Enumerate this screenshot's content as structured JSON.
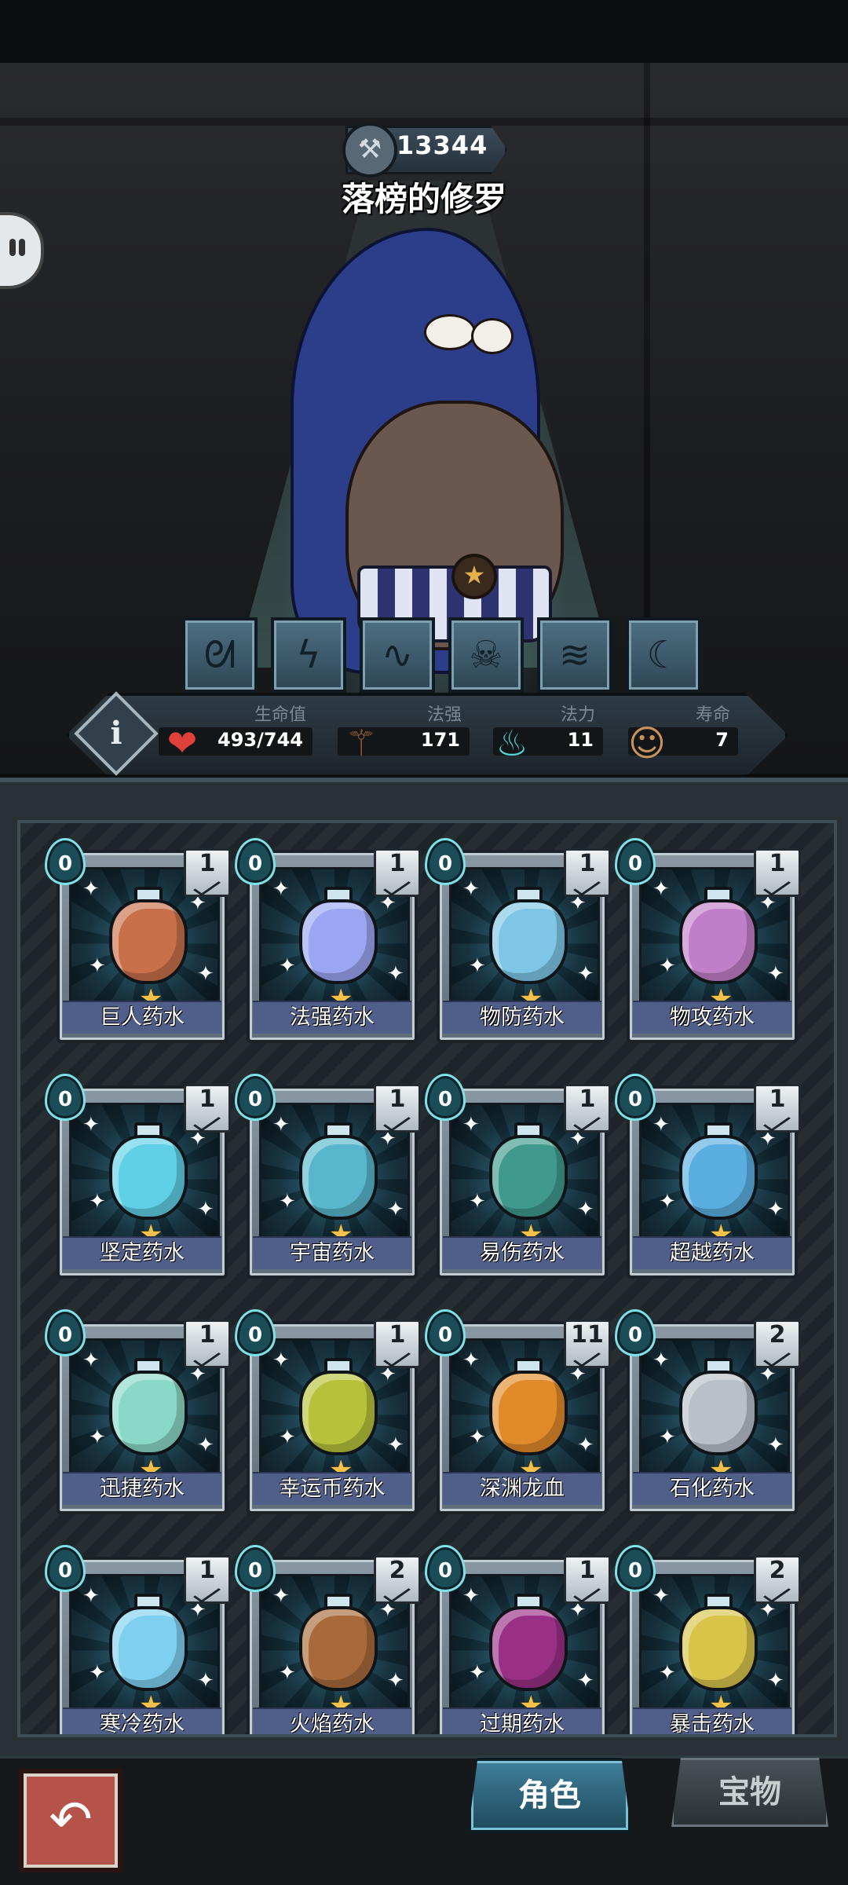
{
  "character": {
    "score": "13344",
    "name": "落榜的修罗"
  },
  "skills": [
    {
      "icon": "beast-skill-icon"
    },
    {
      "icon": "lightning-skill-icon"
    },
    {
      "icon": "wind-skill-icon"
    },
    {
      "icon": "skull-skill-icon"
    },
    {
      "icon": "claw-skill-icon"
    },
    {
      "icon": "wave-skill-icon"
    }
  ],
  "stats": {
    "hp": {
      "label": "生命值",
      "value": "493/744",
      "icon": "heart-icon"
    },
    "magic_power": {
      "label": "法强",
      "value": "171",
      "icon": "staff-icon"
    },
    "mana": {
      "label": "法力",
      "value": "11",
      "icon": "soul-flame-icon"
    },
    "lifespan": {
      "label": "寿命",
      "value": "7",
      "icon": "portrait-icon"
    }
  },
  "potions": [
    {
      "name": "巨人药水",
      "cost": "0",
      "count": "1",
      "color": "#c8704a"
    },
    {
      "name": "法强药水",
      "cost": "0",
      "count": "1",
      "color": "#9aa6f2"
    },
    {
      "name": "物防药水",
      "cost": "0",
      "count": "1",
      "color": "#7fc6e6"
    },
    {
      "name": "物攻药水",
      "cost": "0",
      "count": "1",
      "color": "#c27fc9"
    },
    {
      "name": "坚定药水",
      "cost": "0",
      "count": "1",
      "color": "#5fd0e6"
    },
    {
      "name": "宇宙药水",
      "cost": "0",
      "count": "1",
      "color": "#58b7cc"
    },
    {
      "name": "易伤药水",
      "cost": "0",
      "count": "1",
      "color": "#3f9a8d"
    },
    {
      "name": "超越药水",
      "cost": "0",
      "count": "1",
      "color": "#5aaee0"
    },
    {
      "name": "迅捷药水",
      "cost": "0",
      "count": "1",
      "color": "#8ad8c6"
    },
    {
      "name": "幸运币药水",
      "cost": "0",
      "count": "1",
      "color": "#b7c23a"
    },
    {
      "name": "深渊龙血",
      "cost": "0",
      "count": "11",
      "color": "#e08a2a"
    },
    {
      "name": "石化药水",
      "cost": "0",
      "count": "2",
      "color": "#b8c0c8"
    },
    {
      "name": "寒冷药水",
      "cost": "0",
      "count": "1",
      "color": "#7fd0f0"
    },
    {
      "name": "火焰药水",
      "cost": "0",
      "count": "2",
      "color": "#a86a3a"
    },
    {
      "name": "过期药水",
      "cost": "0",
      "count": "1",
      "color": "#9a2f86"
    },
    {
      "name": "暴击药水",
      "cost": "0",
      "count": "2",
      "color": "#d9c44a"
    }
  ],
  "bottom_tabs": {
    "role": "角色",
    "treasure": "宝物"
  }
}
